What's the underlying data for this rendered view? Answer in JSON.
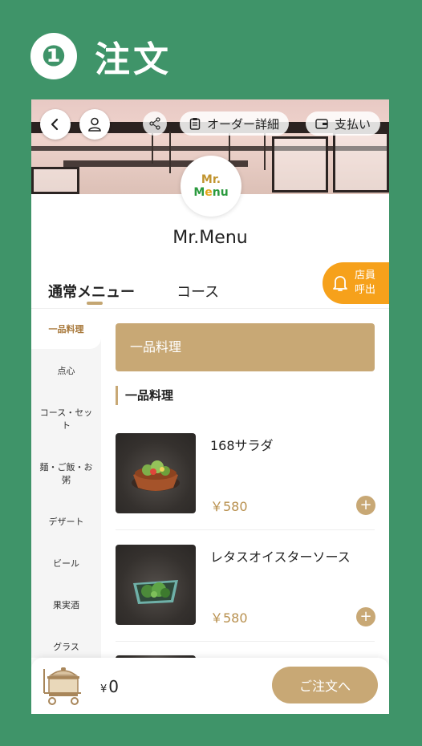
{
  "step": {
    "number": "❶",
    "title": "注文"
  },
  "header": {
    "order_detail_label": "オーダー詳細",
    "payment_label": "支払い"
  },
  "logo": {
    "line1": "Mr.",
    "line2_a": "M",
    "line2_b": "e",
    "line2_c": "nu"
  },
  "shop_name": "Mr.Menu",
  "tabs": [
    {
      "label": "通常メニュー",
      "active": true
    },
    {
      "label": "コース",
      "active": false
    }
  ],
  "call_staff": {
    "line1": "店員",
    "line2": "呼出"
  },
  "sidebar": {
    "items": [
      {
        "label": "一品料理",
        "active": true
      },
      {
        "label": "点心"
      },
      {
        "label": "コース・セット"
      },
      {
        "label": "麺・ご飯・お粥"
      },
      {
        "label": "デザート"
      },
      {
        "label": "ビール"
      },
      {
        "label": "果実酒"
      },
      {
        "label": "グラス"
      }
    ]
  },
  "category_banner": "一品料理",
  "section_title": "一品料理",
  "menu_items": [
    {
      "name": "168サラダ",
      "price": "￥580"
    },
    {
      "name": "レタスオイスターソース",
      "price": "￥580"
    }
  ],
  "cart": {
    "currency": "¥",
    "total": "0",
    "order_button": "ご注文へ"
  },
  "colors": {
    "background": "#3f9469",
    "accent": "#c8a875",
    "call": "#f6a11b"
  }
}
